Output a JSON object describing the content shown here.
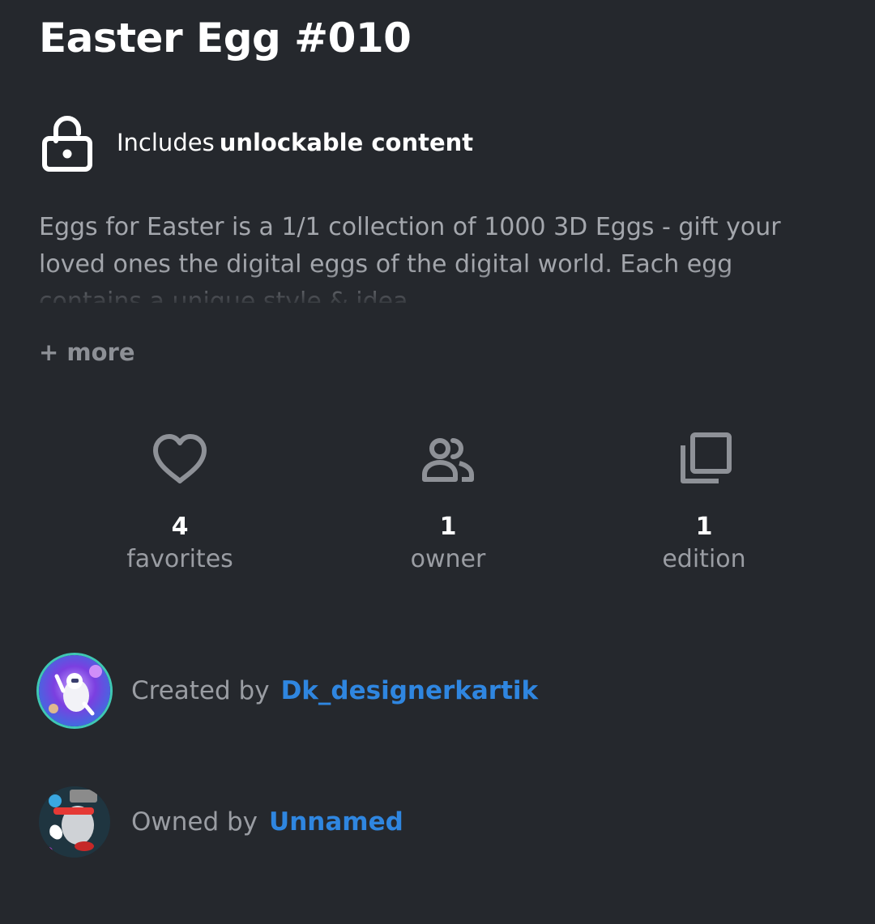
{
  "title": "Easter Egg #010",
  "unlockable": {
    "icon": "lock-open-icon",
    "prefix": "Includes",
    "emphasis": "unlockable content"
  },
  "description": {
    "text": "Eggs for Easter is a 1/1 collection of 1000 3D Eggs - gift your loved ones the digital eggs of the digital world. Each egg contains a unique style & idea",
    "more_label": "+ more"
  },
  "stats": [
    {
      "icon": "heart-icon",
      "value": "4",
      "label": "favorites"
    },
    {
      "icon": "people-icon",
      "value": "1",
      "label": "owner"
    },
    {
      "icon": "editions-icon",
      "value": "1",
      "label": "edition"
    }
  ],
  "creator": {
    "prefix": "Created by",
    "name": "Dk_designerkartik"
  },
  "owner": {
    "prefix": "Owned by",
    "name": "Unnamed"
  },
  "colors": {
    "background": "#25282d",
    "link": "#2f86e0",
    "muted_text": "#9a9da3",
    "icon_gray": "#8e9197"
  }
}
